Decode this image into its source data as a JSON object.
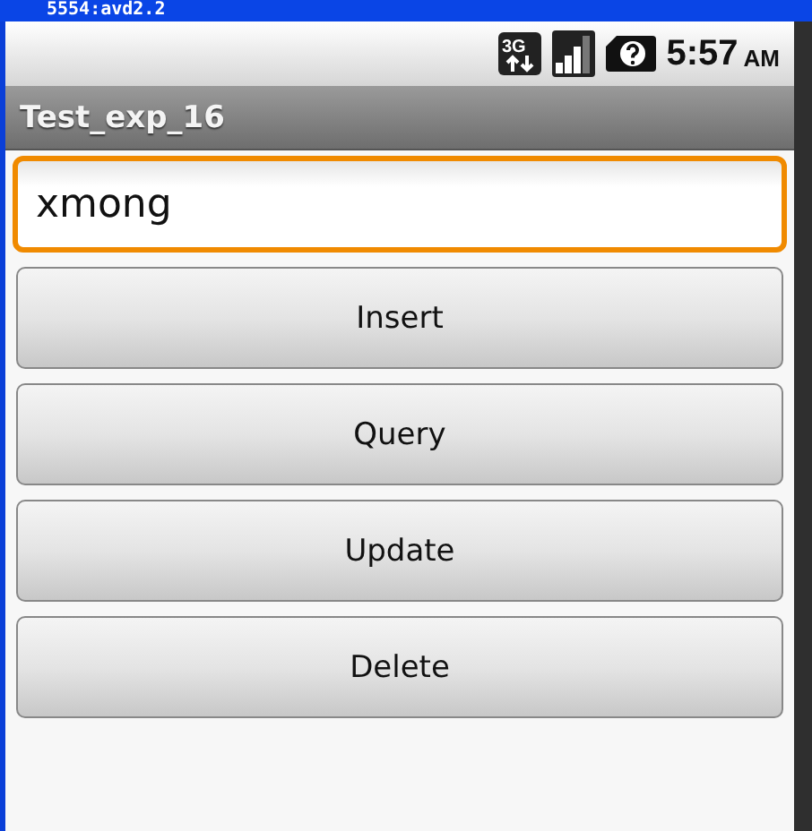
{
  "window": {
    "title": "5554:avd2.2"
  },
  "status_bar": {
    "network": "3G",
    "time": "5:57",
    "am_pm": "AM"
  },
  "app_title": "Test_exp_16",
  "input": {
    "value": "xmong",
    "focused": true
  },
  "buttons": [
    {
      "label": "Insert"
    },
    {
      "label": "Query"
    },
    {
      "label": "Update"
    },
    {
      "label": "Delete"
    }
  ]
}
